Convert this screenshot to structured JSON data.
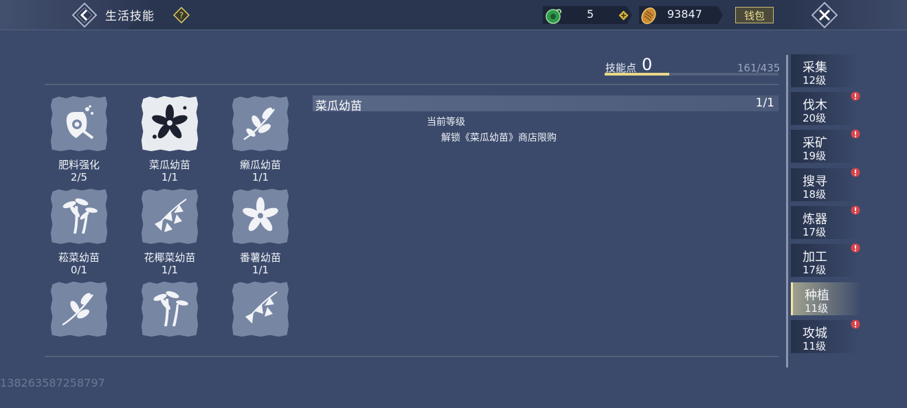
{
  "header": {
    "title": "生活技能",
    "jade_count": "5",
    "coin_count": "93847",
    "wallet_label": "钱包"
  },
  "skill_points": {
    "label": "技能点",
    "value": "0",
    "progress_text": "161/435",
    "progress_fraction": 0.37
  },
  "skills": [
    {
      "name": "肥料强化",
      "level": "2/5",
      "icon": "fertilizer-icon"
    },
    {
      "name": "菜瓜幼苗",
      "level": "1/1",
      "icon": "flower-icon",
      "selected": true
    },
    {
      "name": "癞瓜幼苗",
      "level": "1/1",
      "icon": "leafy-sprout-icon"
    },
    {
      "name": "菘菜幼苗",
      "level": "0/1",
      "icon": "palm-icon"
    },
    {
      "name": "花椰菜幼苗",
      "level": "1/1",
      "icon": "ginkgo-sprout-icon"
    },
    {
      "name": "番薯幼苗",
      "level": "1/1",
      "icon": "flower-icon"
    },
    {
      "name": "",
      "level": "",
      "icon": "leafy-sprout-icon"
    },
    {
      "name": "",
      "level": "",
      "icon": "palm-icon"
    },
    {
      "name": "",
      "level": "",
      "icon": "ginkgo-sprout-icon"
    }
  ],
  "detail": {
    "title": "菜瓜幼苗",
    "level": "1/1",
    "current_level_label": "当前等级",
    "effect": "解锁《菜瓜幼苗》商店限购"
  },
  "tabs": [
    {
      "label": "采集",
      "level": "12级",
      "alert": false
    },
    {
      "label": "伐木",
      "level": "20级",
      "alert": true
    },
    {
      "label": "采矿",
      "level": "19级",
      "alert": true
    },
    {
      "label": "搜寻",
      "level": "18级",
      "alert": true
    },
    {
      "label": "炼器",
      "level": "17级",
      "alert": true
    },
    {
      "label": "加工",
      "level": "17级",
      "alert": true
    },
    {
      "label": "种植",
      "level": "11级",
      "alert": false,
      "active": true
    },
    {
      "label": "攻城",
      "level": "11级",
      "alert": true
    }
  ],
  "uid": "138263587258797",
  "colors": {
    "background": "#3b4a6b",
    "accent": "#e8d987",
    "alert": "#d9434b"
  }
}
